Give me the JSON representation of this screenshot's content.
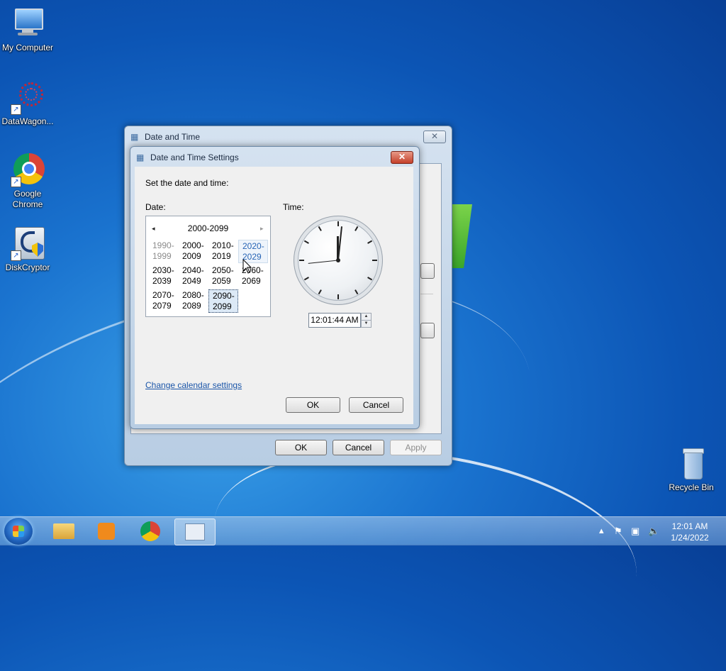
{
  "desktop": {
    "icons": [
      {
        "label": "My Computer",
        "icon": "computer-icon"
      },
      {
        "label": "DataWagon...",
        "icon": "datawagon-icon"
      },
      {
        "label": "Google Chrome",
        "icon": "chrome-icon"
      },
      {
        "label": "DiskCryptor",
        "icon": "diskcryptor-icon"
      },
      {
        "label": "Recycle Bin",
        "icon": "recycle-bin-icon"
      }
    ]
  },
  "parent_dialog": {
    "title": "Date and Time",
    "ok": "OK",
    "cancel": "Cancel",
    "apply": "Apply"
  },
  "settings_dialog": {
    "title": "Date and Time Settings",
    "heading": "Set the date and time:",
    "date_label": "Date:",
    "time_label": "Time:",
    "calendar": {
      "header": "2000-2099",
      "prev": "◂",
      "next": "▸",
      "cells": [
        {
          "top": "1990-",
          "bottom": "1999"
        },
        {
          "top": "2000-",
          "bottom": "2009"
        },
        {
          "top": "2010-",
          "bottom": "2019"
        },
        {
          "top": "2020-",
          "bottom": "2029"
        },
        {
          "top": "2030-",
          "bottom": "2039"
        },
        {
          "top": "2040-",
          "bottom": "2049"
        },
        {
          "top": "2050-",
          "bottom": "2059"
        },
        {
          "top": "2060-",
          "bottom": "2069"
        },
        {
          "top": "2070-",
          "bottom": "2079"
        },
        {
          "top": "2080-",
          "bottom": "2089"
        },
        {
          "top": "2090-",
          "bottom": "2099"
        }
      ]
    },
    "time_value": "12:01:44 AM",
    "change_calendar_link": "Change calendar settings",
    "ok": "OK",
    "cancel": "Cancel"
  },
  "taskbar": {
    "clock_time": "12:01 AM",
    "clock_date": "1/24/2022",
    "tray_expand": "▴"
  },
  "colors": {
    "desktop_blue": "#1a73cf",
    "link_blue": "#1a55a8",
    "close_red": "#c4402a"
  }
}
